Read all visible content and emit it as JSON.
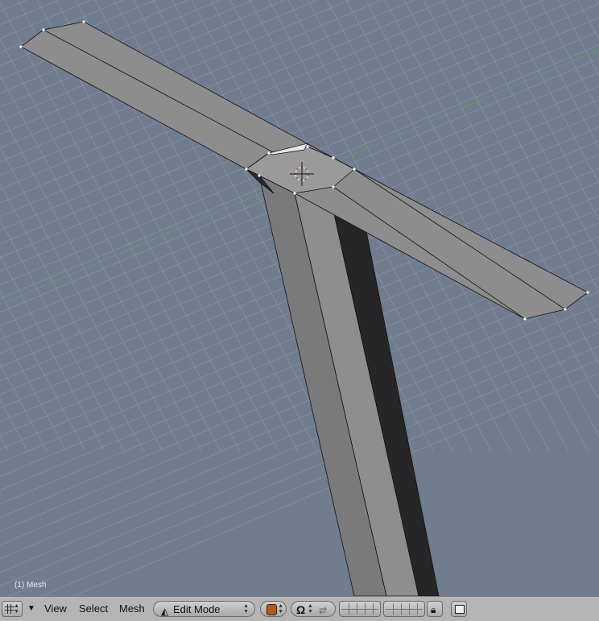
{
  "viewport": {
    "object_label": "(1) Mesh",
    "colors": {
      "background": "#6f7d8f",
      "grid": "#8a94a3",
      "x_axis": "#6a9a66",
      "mesh_face": "#8f8f8f",
      "cursor": "#c0392b"
    }
  },
  "header": {
    "window_type_icon": "grid-icon",
    "menus": [
      "View",
      "Select",
      "Mesh"
    ],
    "mode": {
      "icon": "edit-mode-icon",
      "label": "Edit Mode"
    },
    "draw_type_icon": "shading-icon",
    "pivot_icon": "pivot-icon",
    "manipulator_icon": "manipulator-icon",
    "lock_icon": "lock-icon",
    "render_icon": "render-icon"
  }
}
